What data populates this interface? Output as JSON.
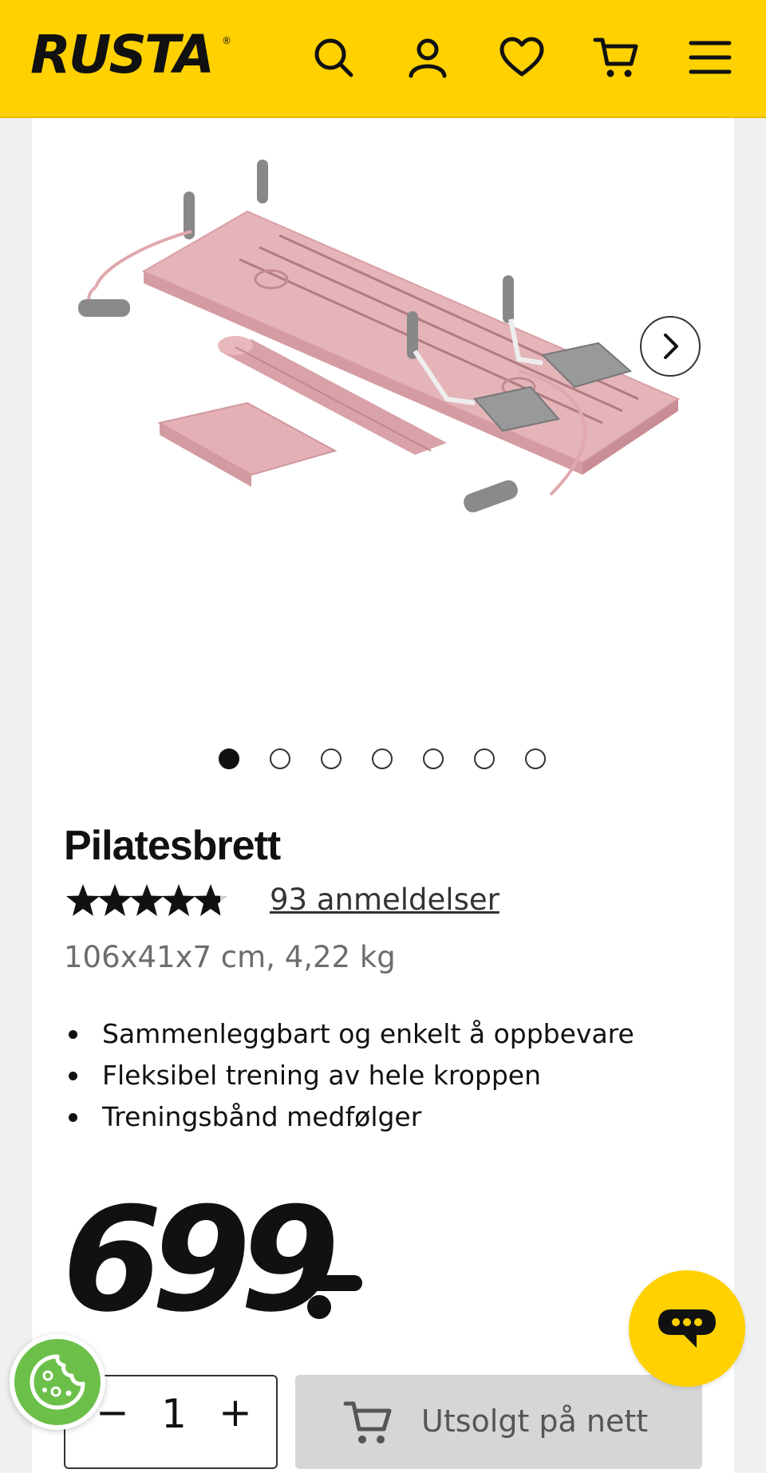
{
  "header": {
    "logo_text": "RUSTA",
    "logo_mark": "®",
    "background_color": "#ffd100",
    "icons": [
      "search-icon",
      "account-icon",
      "heart-icon",
      "cart-icon",
      "menu-icon"
    ]
  },
  "gallery": {
    "image_description_icon": "product-photo",
    "slide_count": 7,
    "active_slide": 1,
    "next_icon": "chevron-right-icon"
  },
  "product": {
    "title": "Pilatesbrett",
    "rating_stars": 4.8,
    "reviews_label": "93 anmeldelser",
    "specs": "106x41x7 cm, 4,22 kg",
    "features": [
      "Sammenleggbart og enkelt å oppbevare",
      "Fleksibel trening av hele kroppen",
      "Treningsbånd medfølger"
    ],
    "price": "699"
  },
  "purchase": {
    "qty_minus": "−",
    "qty_value": "1",
    "qty_plus": "+",
    "cart_label": "Utsolgt på nett",
    "cart_bg": "#d6d6d6"
  },
  "floating": {
    "chat_icon": "chat-bubble-icon",
    "cookie_icon": "cookie-icon"
  }
}
